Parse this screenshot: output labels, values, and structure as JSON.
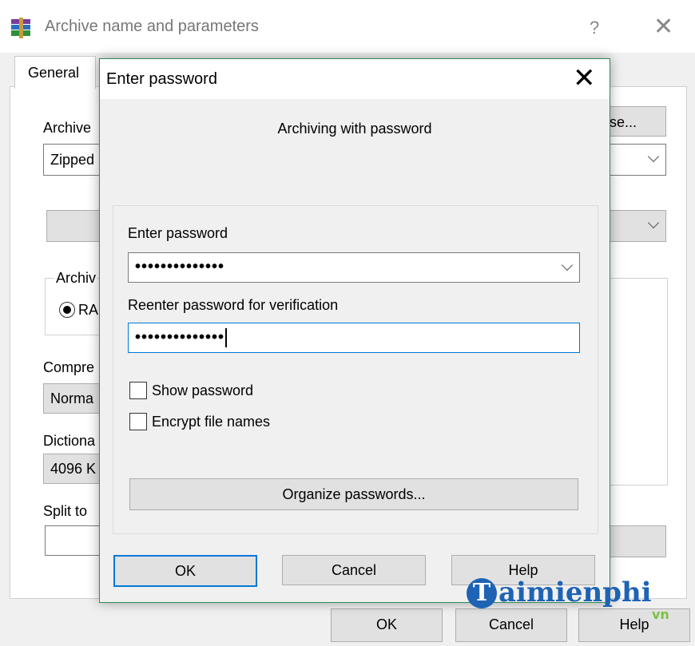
{
  "background_window": {
    "title": "Archive name and parameters",
    "help_glyph": "?",
    "close_glyph": "✕",
    "tab_label": "General",
    "labels": {
      "archive_name": "Archive",
      "archive_format": "Archiv",
      "rar_option": "RA",
      "compression": "Compre",
      "dictionary": "Dictiona",
      "split": "Split to"
    },
    "values": {
      "archive_name": "Zipped",
      "compression": "Norma",
      "dictionary": "4096 K"
    },
    "browse_label": "se...",
    "buttons": {
      "ok": "OK",
      "cancel": "Cancel",
      "help": "Help"
    }
  },
  "dialog": {
    "title": "Enter password",
    "close_glyph": "✕",
    "heading": "Archiving with password",
    "enter_password_label": "Enter password",
    "password_value": "••••••••••••••",
    "reenter_label": "Reenter password for verification",
    "reenter_value": "••••••••••••••",
    "show_password_label": "Show password",
    "encrypt_names_label": "Encrypt file names",
    "organize_button": "Organize passwords...",
    "buttons": {
      "ok": "OK",
      "cancel": "Cancel",
      "help": "Help"
    }
  },
  "watermark": {
    "letter": "T",
    "text": "aimienphi",
    "suffix": "vn"
  },
  "colors": {
    "accent": "#0078d7",
    "dialog_border": "#2e8b57",
    "watermark_blue": "#1e63b4",
    "watermark_green": "#7cc142"
  }
}
